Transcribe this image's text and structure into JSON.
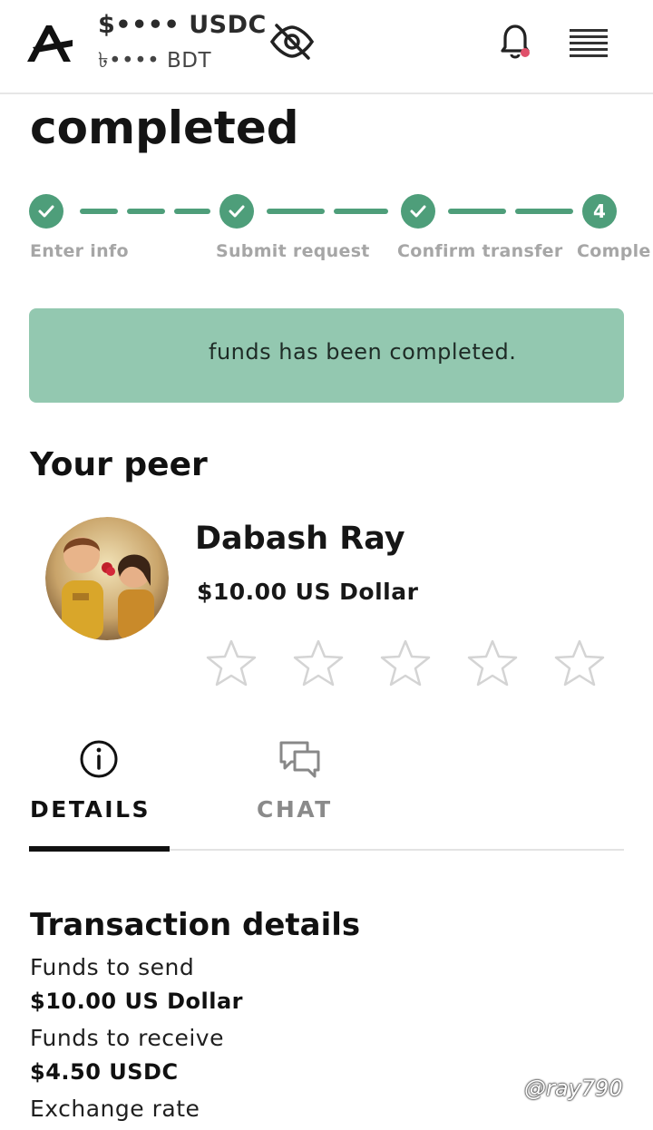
{
  "header": {
    "balance_usdc": "$•••• USDC",
    "balance_bdt": "৳•••• BDT",
    "icons": [
      "logo-icon",
      "eye-off-icon",
      "bell-icon",
      "menu-icon"
    ],
    "notification_dot_color": "#e0506a"
  },
  "page": {
    "title": "completed"
  },
  "stepper": {
    "color": "#4e9e7a",
    "steps": [
      {
        "label": "Enter info",
        "state": "done"
      },
      {
        "label": "Submit request",
        "state": "done"
      },
      {
        "label": "Confirm transfer",
        "state": "done"
      },
      {
        "label": "Comple",
        "state": "current",
        "number": "4"
      }
    ]
  },
  "banner": {
    "text": "funds has been completed.",
    "color": "#93c8b0"
  },
  "peer": {
    "section_title": "Your peer",
    "name": "Dabash Ray",
    "amount": "$10.00 US Dollar",
    "rating": 0,
    "max_rating": 5
  },
  "tabs": [
    {
      "label": "DETAILS",
      "icon": "info-icon",
      "active": true
    },
    {
      "label": "CHAT",
      "icon": "chat-icon",
      "active": false
    }
  ],
  "transaction": {
    "title": "Transaction details",
    "funds_to_send_label": "Funds to send",
    "funds_to_send_value": "$10.00 US Dollar",
    "funds_to_receive_label": "Funds to receive",
    "funds_to_receive_value": "$4.50 USDC",
    "exchange_rate_label": "Exchange rate"
  },
  "watermark": "@ray790"
}
